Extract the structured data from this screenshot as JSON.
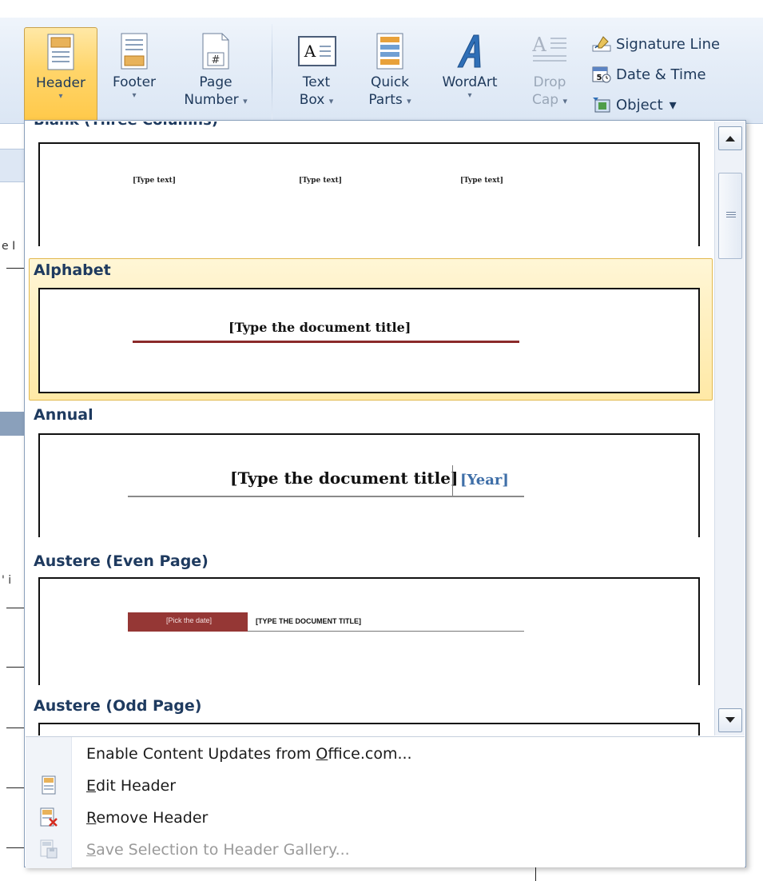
{
  "ribbon": {
    "buttons": [
      {
        "id": "header",
        "label": "Header",
        "arrow": "▾"
      },
      {
        "id": "footer",
        "label": "Footer",
        "arrow": "▾"
      },
      {
        "id": "page_number",
        "label_top": "Page",
        "label_bottom": "Number",
        "arrow": "▾"
      },
      {
        "id": "text_box",
        "label_top": "Text",
        "label_bottom": "Box",
        "arrow": "▾"
      },
      {
        "id": "quick_parts",
        "label_top": "Quick",
        "label_bottom": "Parts",
        "arrow": "▾"
      },
      {
        "id": "wordart",
        "label": "WordArt",
        "arrow": "▾"
      },
      {
        "id": "drop_cap",
        "label_top": "Drop",
        "label_bottom": "Cap",
        "arrow": "▾"
      }
    ],
    "small_buttons": [
      {
        "id": "signature_line",
        "label": "Signature Line"
      },
      {
        "id": "date_time",
        "label": "Date & Time"
      },
      {
        "id": "object",
        "label": "Object",
        "arrow": "▾"
      }
    ]
  },
  "gallery": {
    "items": [
      {
        "name": "Blank (Three Columns)",
        "placeholders": [
          "[Type text]",
          "[Type text]",
          "[Type text]"
        ]
      },
      {
        "name": "Alphabet",
        "title": "[Type the document title]",
        "selected": true
      },
      {
        "name": "Annual",
        "title": "[Type the document title]",
        "year": "[Year]"
      },
      {
        "name": "Austere (Even Page)",
        "date": "[Pick the date]",
        "title": "[TYPE THE DOCUMENT TITLE]"
      },
      {
        "name": "Austere (Odd Page)"
      }
    ]
  },
  "menu": {
    "enable_updates": {
      "pre": "Enable Content Updates from ",
      "accel": "O",
      "post": "ffice.com..."
    },
    "edit_header": {
      "accel": "E",
      "post": "dit Header"
    },
    "remove_header": {
      "accel": "R",
      "post": "emove Header"
    },
    "save_selection": {
      "accel": "S",
      "post": "ave Selection to Header Gallery..."
    }
  },
  "document": {
    "stub_text_1": "e I",
    "stub_text_2": "' i"
  }
}
